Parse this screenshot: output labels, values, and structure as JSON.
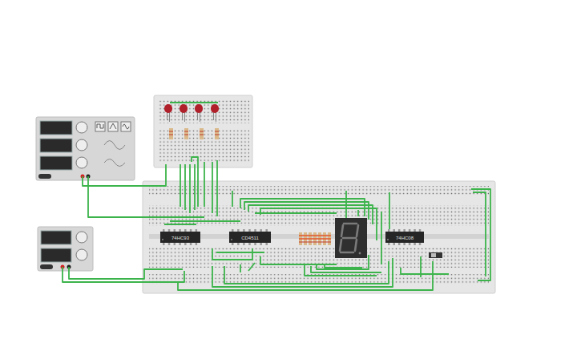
{
  "chips": [
    {
      "label": "74HC93"
    },
    {
      "label": "CD4511"
    },
    {
      "label": "74HC08"
    }
  ],
  "leds": [
    {
      "lit": false
    },
    {
      "lit": false
    },
    {
      "lit": false
    },
    {
      "lit": false
    }
  ],
  "seven_segment": {
    "lit": false
  },
  "switch": {
    "on": false
  }
}
